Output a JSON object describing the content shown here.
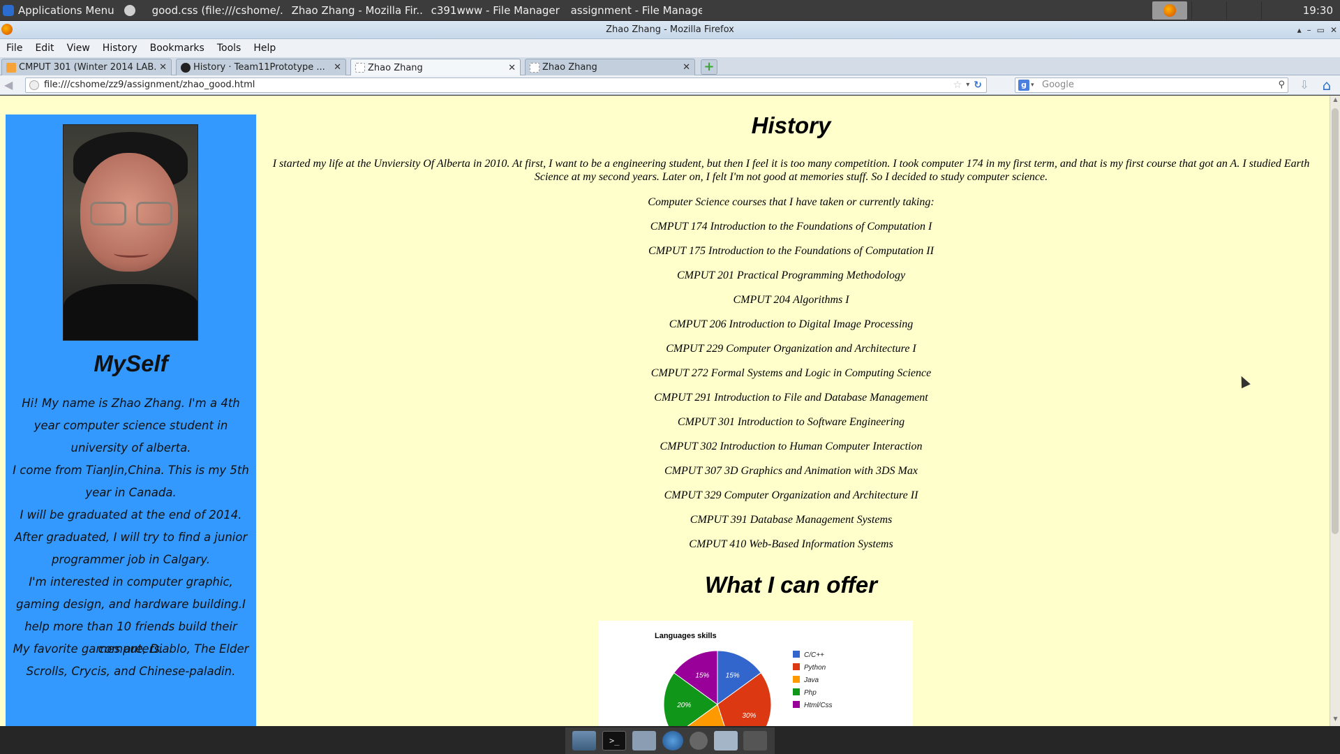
{
  "top_panel": {
    "apps_menu": "Applications Menu",
    "tasks": [
      {
        "label": "good.css (file:///cshome/...",
        "icon": "css-file-icon"
      },
      {
        "label": "Zhao Zhang - Mozilla Fir...",
        "icon": "firefox-icon"
      },
      {
        "label": "c391www - File Manager",
        "icon": "folder-icon"
      },
      {
        "label": "assignment - File Manager",
        "icon": "folder-icon"
      }
    ],
    "clock": "19:30"
  },
  "window": {
    "title": "Zhao Zhang - Mozilla Firefox"
  },
  "menubar": [
    "File",
    "Edit",
    "View",
    "History",
    "Bookmarks",
    "Tools",
    "Help"
  ],
  "tabs": [
    {
      "label": "CMPUT 301 (Winter 2014 LAB...",
      "active": false
    },
    {
      "label": "History · Team11Prototype ...",
      "active": false
    },
    {
      "label": "Zhao Zhang",
      "active": true
    },
    {
      "label": "Zhao Zhang",
      "active": false
    }
  ],
  "navbar": {
    "url": "file:///cshome/zz9/assignment/zhao_good.html",
    "search_placeholder": "Google"
  },
  "sidebar": {
    "title": "MySelf",
    "paragraphs": [
      "Hi! My name is Zhao Zhang. I'm a 4th year computer science student in university of alberta.",
      "I come from TianJin,China. This is my 5th year in Canada.",
      "I will be graduated at the end of 2014. After graduated, I will try to find a junior programmer job in Calgary.",
      "I'm interested in computer graphic, gaming design, and hardware building.I help more than 10 friends build their computers.",
      "My favorite games are, Diablo, The Elder Scrolls, Crycis, and Chinese-paladin."
    ]
  },
  "main": {
    "history_title": "History",
    "intro": "I started my life at the Unviersity Of Alberta in 2010. At first, I want to be a engineering student, but then I feel it is too many competition. I took computer 174 in my first term, and that is my first course that got an A. I studied Earth Science at my second years. Later on, I felt I'm not good at memories stuff. So I decided to study computer science.",
    "courses_heading": "Computer Science courses that I have taken or currently taking:",
    "courses": [
      "CMPUT 174 Introduction to the Foundations of Computation I",
      "CMPUT 175 Introduction to the Foundations of Computation II",
      "CMPUT 201 Practical Programming Methodology",
      "CMPUT 204 Algorithms I",
      "CMPUT 206 Introduction to Digital Image Processing",
      "CMPUT 229 Computer Organization and Architecture I",
      "CMPUT 272 Formal Systems and Logic in Computing Science",
      "CMPUT 291 Introduction to File and Database Management",
      "CMPUT 301 Introduction to Software Engineering",
      "CMPUT 302 Introduction to Human Computer Interaction",
      "CMPUT 307 3D Graphics and Animation with 3DS Max",
      "CMPUT 329 Computer Organization and Architecture II",
      "CMPUT 391 Database Management Systems",
      "CMPUT 410 Web-Based Information Systems"
    ],
    "offer_title": "What I can offer"
  },
  "chart_data": {
    "type": "pie",
    "title": "Languages skills",
    "categories": [
      "C/C++",
      "Python",
      "Java",
      "Php",
      "Html/Css"
    ],
    "values": [
      15,
      30,
      20,
      20,
      15
    ],
    "labels_visible": [
      "15%",
      "30%",
      "",
      "20%",
      "15%"
    ],
    "colors": [
      "#3366cc",
      "#dc3912",
      "#ff9900",
      "#109618",
      "#990099"
    ],
    "legend": "right"
  }
}
